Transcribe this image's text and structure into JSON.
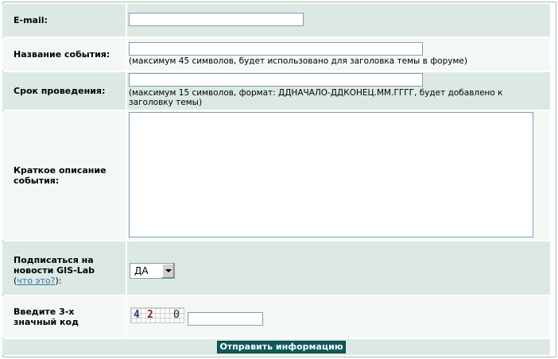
{
  "form": {
    "email": {
      "label": "E-mail:",
      "value": ""
    },
    "event_name": {
      "label": "Название события:",
      "value": "",
      "hint": "(максимум 45 символов, будет использовано для заголовка темы в форуме)"
    },
    "event_period": {
      "label": "Срок проведения:",
      "value": "",
      "hint": "(максимум 15 символов, формат: ДДНАЧАЛО-ДДКОНЕЦ.ММ.ГГГГ, будет добавлено к заголовку темы)"
    },
    "description": {
      "label": "Краткое описание события:",
      "value": ""
    },
    "subscribe": {
      "label": "Подписаться на новости GIS-Lab",
      "link_prefix": "(",
      "link_text": "что это?",
      "link_suffix": "):",
      "selected": "ДА"
    },
    "captcha": {
      "label": "Введите 3-х значный код",
      "glyphs": [
        "4",
        "2",
        "0"
      ],
      "value": ""
    },
    "submit_label": "Отправить информацию"
  },
  "colors": {
    "row_dark": "#dce9e2",
    "row_light": "#f3f8f5",
    "border": "#a9bcb4",
    "button_bg": "#0e5a5c",
    "link": "#3a6fb0"
  }
}
